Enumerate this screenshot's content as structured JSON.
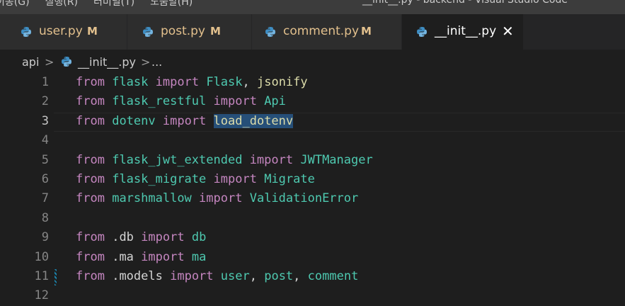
{
  "menubar": {
    "items": [
      "이동(G)",
      "실행(R)",
      "터미널(T)",
      "도움말(H)"
    ]
  },
  "window_title": "__init__.py - backend - Visual Studio Code",
  "tabs": [
    {
      "label": "user.py",
      "modified": "M"
    },
    {
      "label": "post.py",
      "modified": "M"
    },
    {
      "label": "comment.py",
      "modified": "M"
    },
    {
      "label": "__init__.py",
      "close": "✕"
    }
  ],
  "breadcrumb": {
    "folder": "api",
    "sep": ">",
    "file": "__init__.py",
    "more": "..."
  },
  "editor": {
    "current_line": 3,
    "lines": [
      {
        "n": "1",
        "tokens": [
          {
            "t": "from",
            "c": "kw"
          },
          {
            "t": " "
          },
          {
            "t": "flask",
            "c": "mod"
          },
          {
            "t": " "
          },
          {
            "t": "import",
            "c": "kw"
          },
          {
            "t": " "
          },
          {
            "t": "Flask",
            "c": "mod"
          },
          {
            "t": ", "
          },
          {
            "t": "jsonify",
            "c": "fn"
          }
        ]
      },
      {
        "n": "2",
        "tokens": [
          {
            "t": "from",
            "c": "kw"
          },
          {
            "t": " "
          },
          {
            "t": "flask_restful",
            "c": "mod"
          },
          {
            "t": " "
          },
          {
            "t": "import",
            "c": "kw"
          },
          {
            "t": " "
          },
          {
            "t": "Api",
            "c": "mod"
          }
        ]
      },
      {
        "n": "3",
        "tokens": [
          {
            "t": "from",
            "c": "kw"
          },
          {
            "t": " "
          },
          {
            "t": "dotenv",
            "c": "mod"
          },
          {
            "t": " "
          },
          {
            "t": "import",
            "c": "kw"
          },
          {
            "t": " "
          },
          {
            "t": "load_dotenv",
            "c": "hl"
          }
        ]
      },
      {
        "n": "4",
        "tokens": []
      },
      {
        "n": "5",
        "tokens": [
          {
            "t": "from",
            "c": "kw"
          },
          {
            "t": " "
          },
          {
            "t": "flask_jwt_extended",
            "c": "mod"
          },
          {
            "t": " "
          },
          {
            "t": "import",
            "c": "kw"
          },
          {
            "t": " "
          },
          {
            "t": "JWTManager",
            "c": "mod"
          }
        ]
      },
      {
        "n": "6",
        "tokens": [
          {
            "t": "from",
            "c": "kw"
          },
          {
            "t": " "
          },
          {
            "t": "flask_migrate",
            "c": "mod"
          },
          {
            "t": " "
          },
          {
            "t": "import",
            "c": "kw"
          },
          {
            "t": " "
          },
          {
            "t": "Migrate",
            "c": "mod"
          }
        ]
      },
      {
        "n": "7",
        "tokens": [
          {
            "t": "from",
            "c": "kw"
          },
          {
            "t": " "
          },
          {
            "t": "marshmallow",
            "c": "mod"
          },
          {
            "t": " "
          },
          {
            "t": "import",
            "c": "kw"
          },
          {
            "t": " "
          },
          {
            "t": "ValidationError",
            "c": "mod"
          }
        ]
      },
      {
        "n": "8",
        "tokens": []
      },
      {
        "n": "9",
        "tokens": [
          {
            "t": "from",
            "c": "kw"
          },
          {
            "t": " "
          },
          {
            "t": ".db",
            "c": "pl"
          },
          {
            "t": " "
          },
          {
            "t": "import",
            "c": "kw"
          },
          {
            "t": " "
          },
          {
            "t": "db",
            "c": "mod"
          }
        ]
      },
      {
        "n": "10",
        "tokens": [
          {
            "t": "from",
            "c": "kw"
          },
          {
            "t": " "
          },
          {
            "t": ".ma",
            "c": "pl"
          },
          {
            "t": " "
          },
          {
            "t": "import",
            "c": "kw"
          },
          {
            "t": " "
          },
          {
            "t": "ma",
            "c": "mod"
          }
        ]
      },
      {
        "n": "11",
        "tokens": [
          {
            "t": "from",
            "c": "kw"
          },
          {
            "t": " "
          },
          {
            "t": ".models",
            "c": "pl"
          },
          {
            "t": " "
          },
          {
            "t": "import",
            "c": "kw"
          },
          {
            "t": " "
          },
          {
            "t": "user",
            "c": "mod"
          },
          {
            "t": ", "
          },
          {
            "t": "post",
            "c": "mod"
          },
          {
            "t": ", "
          },
          {
            "t": "comment",
            "c": "mod"
          }
        ]
      },
      {
        "n": "12",
        "tokens": []
      }
    ]
  },
  "colors": {
    "keyword": "#c586c0",
    "module": "#4ec9b0",
    "function": "#dcdcaa",
    "modified": "#e2c08d",
    "selection": "#264f78"
  }
}
